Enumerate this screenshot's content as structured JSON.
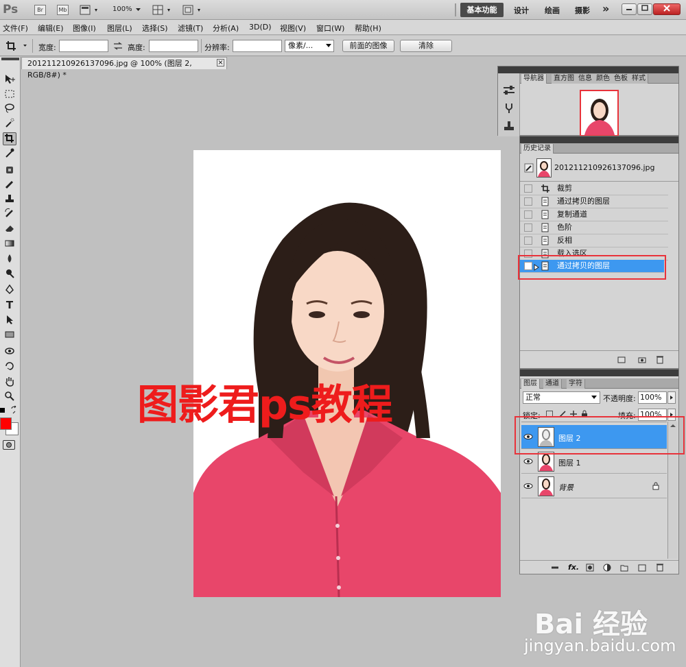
{
  "app": {
    "logo": "Ps",
    "br_label": "Br",
    "mb_label": "Mb",
    "zoom": "100%",
    "workspaces": [
      "基本功能",
      "设计",
      "绘画",
      "摄影"
    ],
    "more": "»"
  },
  "menu": [
    "文件(F)",
    "编辑(E)",
    "图像(I)",
    "图层(L)",
    "选择(S)",
    "滤镜(T)",
    "分析(A)",
    "3D(D)",
    "视图(V)",
    "窗口(W)",
    "帮助(H)"
  ],
  "options": {
    "width_label": "宽度:",
    "height_label": "高度:",
    "resolution_label": "分辨率:",
    "unit": "像素/...",
    "front_image": "前面的图像",
    "clear": "清除"
  },
  "document": {
    "tab_title": "201211210926137096.jpg @ 100% (图层 2, RGB/8#) *",
    "close": "×",
    "overlay_text": "图影君ps教程"
  },
  "navigator": {
    "tabs": [
      "导航器",
      "直方图",
      "信息",
      "颜色",
      "色板",
      "样式"
    ]
  },
  "history": {
    "title": "历史记录",
    "snapshot": "201211210926137096.jpg",
    "steps": [
      "裁剪",
      "通过拷贝的图层",
      "复制通道",
      "色阶",
      "反相",
      "载入选区",
      "通过拷贝的图层"
    ]
  },
  "layers": {
    "tabs": [
      "图层",
      "通道",
      "字符"
    ],
    "blend_mode": "正常",
    "opacity_label": "不透明度:",
    "opacity": "100%",
    "lock_label": "锁定:",
    "fill_label": "填充:",
    "fill": "100%",
    "items": [
      "图层 2",
      "图层 1",
      "背景"
    ]
  },
  "watermark": {
    "brand": "Bai 经验",
    "url": "jingyan.baidu.com"
  },
  "colors": {
    "foreground": "#ff0000",
    "background": "#ffffff",
    "selection": "#3d98f0",
    "highlight_box": "#e8323a"
  }
}
